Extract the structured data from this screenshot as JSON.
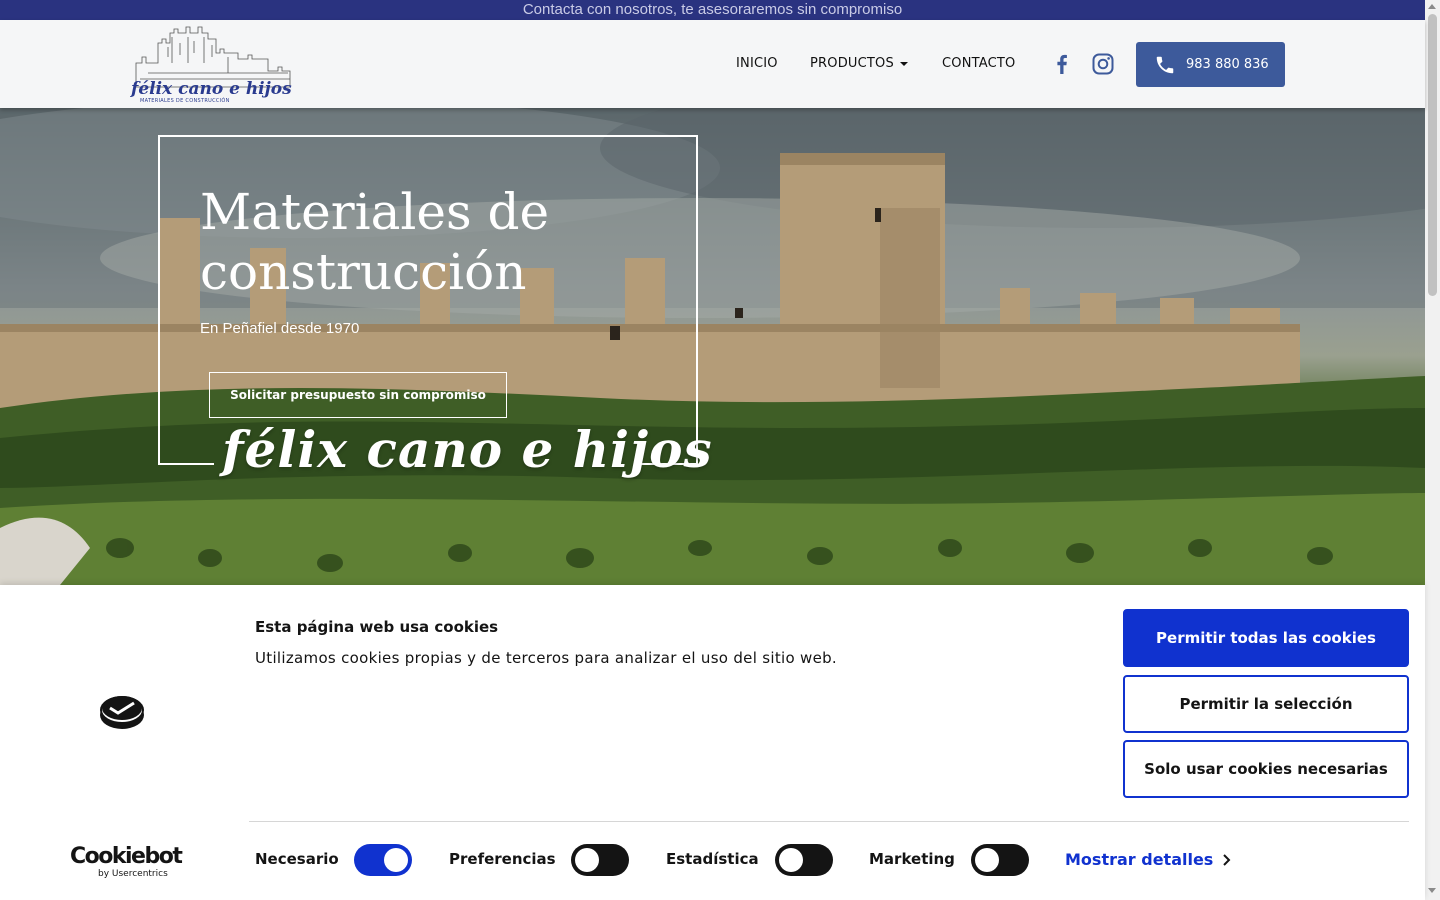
{
  "topbar": {
    "text": "Contacta con nosotros, te asesoraremos sin compromiso"
  },
  "header": {
    "logo_text": "félix cano e hijos",
    "logo_subtext": "MATERIALES DE CONSTRUCCIÓN",
    "nav": [
      {
        "label": "INICIO"
      },
      {
        "label": "PRODUCTOS"
      },
      {
        "label": "CONTACTO"
      }
    ],
    "social": [
      "facebook-icon",
      "instagram-icon"
    ],
    "phone": "983 880 836"
  },
  "hero": {
    "title": "Materiales de construcción",
    "subtitle": "En Peñafiel desde 1970",
    "cta": "Solicitar presupuesto sin compromiso",
    "script": "félix cano e hijos"
  },
  "cookie": {
    "title": "Esta página web usa cookies",
    "text": "Utilizamos cookies propias y de terceros para analizar el uso del sitio web.",
    "buttons": {
      "allow_all": "Permitir todas las cookies",
      "allow_selection": "Permitir la selección",
      "necessary_only": "Solo usar cookies necesarias"
    },
    "brand": {
      "name": "Cookiebot",
      "by": "by Usercentrics"
    },
    "toggles": [
      {
        "label": "Necesario",
        "on": true
      },
      {
        "label": "Preferencias",
        "on": false
      },
      {
        "label": "Estadística",
        "on": false
      },
      {
        "label": "Marketing",
        "on": false
      }
    ],
    "details_link": "Mostrar detalles"
  },
  "colors": {
    "topbar": "#2a3380",
    "phone_button": "#3d5a9b",
    "cookie_primary": "#1032cf"
  }
}
